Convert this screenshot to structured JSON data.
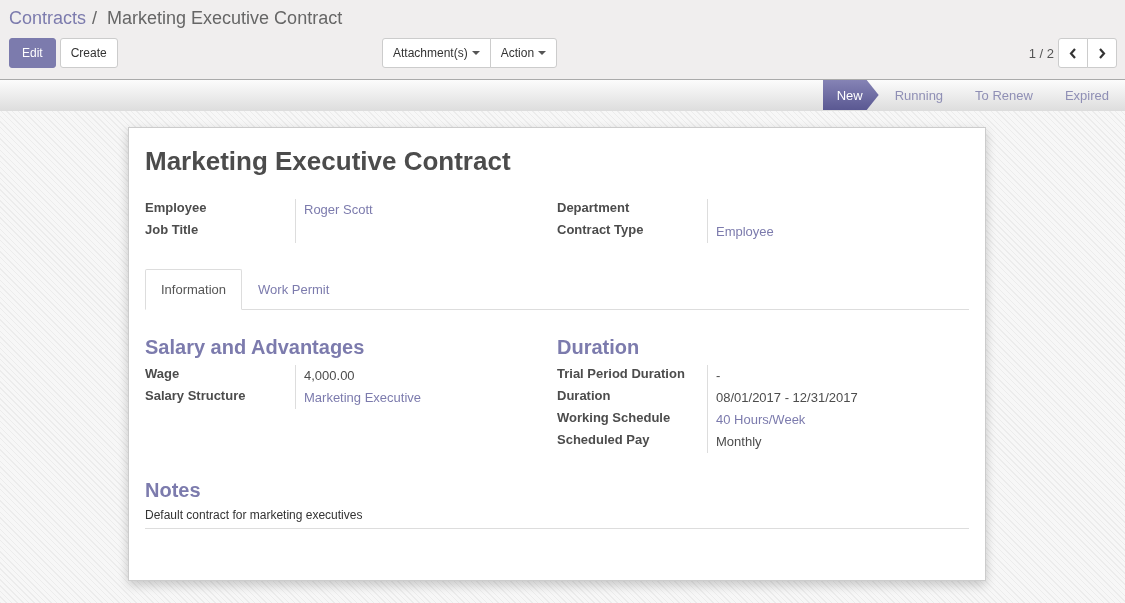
{
  "breadcrumb": {
    "parent": "Contracts",
    "separator": "/",
    "current": "Marketing Executive Contract"
  },
  "buttons": {
    "edit": "Edit",
    "create": "Create"
  },
  "menus": [
    "Attachment(s)",
    "Action"
  ],
  "pager": {
    "text": "1 / 2"
  },
  "stages": [
    {
      "label": "New",
      "selected": true
    },
    {
      "label": "Running",
      "selected": false
    },
    {
      "label": "To Renew",
      "selected": false
    },
    {
      "label": "Expired",
      "selected": false
    }
  ],
  "title": "Marketing Executive Contract",
  "header_groups": [
    {
      "fields": [
        {
          "label": "Employee",
          "value": "Roger Scott",
          "kind": "link"
        },
        {
          "label": "Job Title"
        }
      ]
    },
    {
      "fields": [
        {
          "label": "Department"
        },
        {
          "label": "Contract Type",
          "value": "Employee",
          "kind": "link"
        }
      ]
    }
  ],
  "tabs": [
    {
      "label": "Information",
      "selected": true
    },
    {
      "label": "Work Permit",
      "selected": false
    }
  ],
  "sections": [
    {
      "title": "Salary and Advantages",
      "fields": [
        {
          "label": "Wage",
          "value": "4,000.00",
          "kind": "text"
        },
        {
          "label": "Salary Structure",
          "value": "Marketing Executive",
          "kind": "link"
        }
      ]
    },
    {
      "title": "Duration",
      "fields": [
        {
          "label": "Trial Period Duration",
          "value": "-",
          "kind": "text"
        },
        {
          "label": "Duration",
          "value": "08/01/2017 - 12/31/2017",
          "kind": "text"
        },
        {
          "label": "Working Schedule",
          "value": "40 Hours/Week",
          "kind": "link"
        },
        {
          "label": "Scheduled Pay",
          "value": "Monthly",
          "kind": "text"
        }
      ]
    }
  ],
  "notes": {
    "title": "Notes",
    "text": "Default contract for marketing executives"
  }
}
